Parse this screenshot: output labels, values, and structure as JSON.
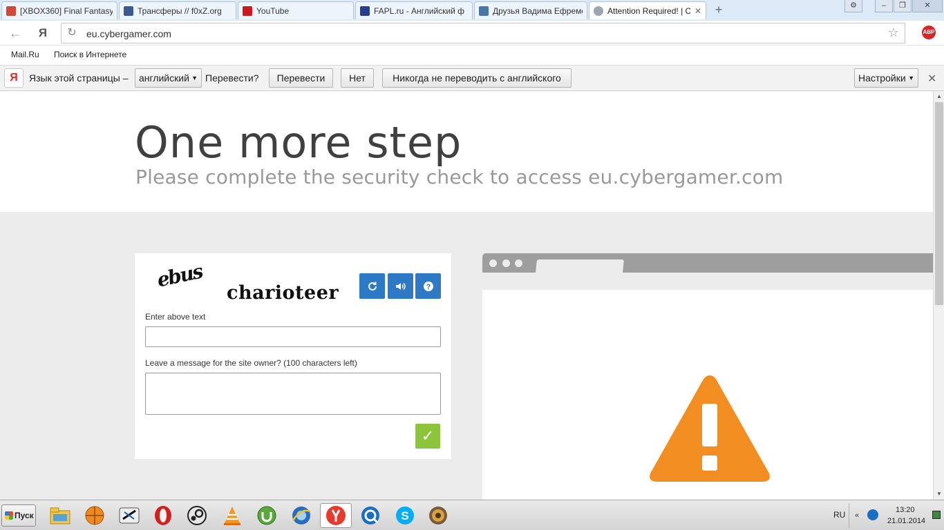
{
  "browser": {
    "tabs": [
      {
        "title": "[XBOX360] Final Fantasy",
        "favicon_color": "#d04a3a",
        "active": false
      },
      {
        "title": "Трансферы // f0xZ.org",
        "favicon_color": "#3a5a92",
        "active": false
      },
      {
        "title": "YouTube",
        "favicon_color": "#cc181e",
        "active": false
      },
      {
        "title": "FAPL.ru - Английский ф",
        "favicon_color": "#273d8e",
        "active": false
      },
      {
        "title": "Друзья Вадима Ефремо",
        "favicon_color": "#4a76a8",
        "active": false
      },
      {
        "title": "Attention Required! | Clo",
        "favicon_color": "#9aa6b2",
        "active": true
      }
    ],
    "new_tab": "+",
    "window_controls": {
      "settings": "⚙",
      "minimize": "–",
      "restore": "❐",
      "close": "✕"
    },
    "address": "eu.cybergamer.com",
    "ya_label": "Я",
    "abp_label": "ABP"
  },
  "bookmarks": [
    "Mail.Ru",
    "Поиск в Интернете"
  ],
  "translate_bar": {
    "logo": "Я",
    "prompt": "Язык этой страницы –",
    "language": "английский",
    "question": "Перевести?",
    "translate": "Перевести",
    "no": "Нет",
    "never": "Никогда не переводить с английского",
    "settings": "Настройки"
  },
  "page": {
    "title": "One more step",
    "subtitle": "Please complete the security check to access eu.cybergamer.com",
    "captcha": {
      "word1": "ebus",
      "word2": "charioteer",
      "enter_label": "Enter above text",
      "enter_value": "",
      "message_label": "Leave a message for the site owner? (100 characters left)",
      "message_value": "",
      "submit": "✓"
    }
  },
  "colors": {
    "captcha_button": "#2e79c5",
    "submit_button": "#8cc43c",
    "warning": "#f28d22"
  },
  "taskbar": {
    "start": "Пуск",
    "apps": [
      "file-manager-icon",
      "basketball-app-icon",
      "xeon-app-icon",
      "opera-icon",
      "steam-icon",
      "vlc-icon",
      "utorrent-icon",
      "ie-icon",
      "yandex-browser-icon",
      "qip-icon",
      "skype-icon",
      "photo-app-icon"
    ],
    "lang": "RU",
    "tray_arrow": "«",
    "time": "13:20",
    "date": "21.01.2014"
  }
}
